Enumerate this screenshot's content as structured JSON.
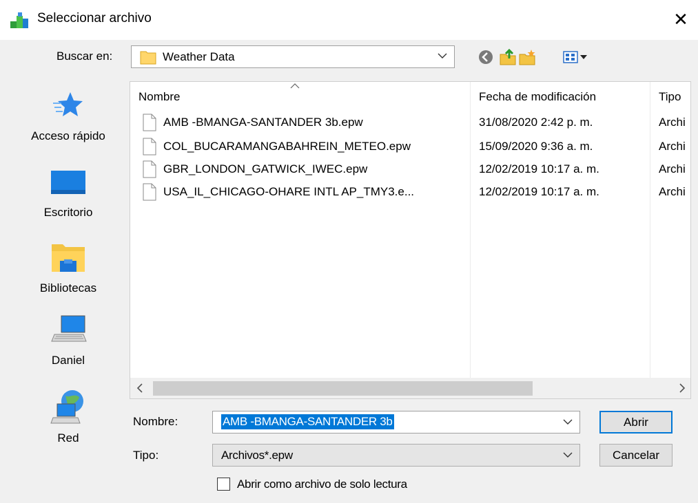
{
  "window": {
    "title": "Seleccionar archivo",
    "close_glyph": "✕"
  },
  "look_in": {
    "label": "Buscar en:",
    "value": "Weather Data"
  },
  "toolbar": {
    "icons": [
      "back-icon",
      "up-folder-icon",
      "new-folder-icon",
      "view-menu-icon"
    ]
  },
  "places": [
    {
      "label": "Acceso rápido",
      "icon": "star-icon"
    },
    {
      "label": "Escritorio",
      "icon": "desktop-icon"
    },
    {
      "label": "Bibliotecas",
      "icon": "libraries-icon"
    },
    {
      "label": "Daniel",
      "icon": "computer-icon"
    },
    {
      "label": "Red",
      "icon": "network-icon"
    }
  ],
  "file_list": {
    "columns": [
      "Nombre",
      "Fecha de modificación",
      "Tipo"
    ],
    "rows": [
      {
        "name": "AMB -BMANGA-SANTANDER 3b.epw",
        "date": "31/08/2020 2:42 p. m.",
        "type": "Archi"
      },
      {
        "name": "COL_BUCARAMANGABAHREIN_METEO.epw",
        "date": "15/09/2020 9:36 a. m.",
        "type": "Archi"
      },
      {
        "name": "GBR_LONDON_GATWICK_IWEC.epw",
        "date": "12/02/2019 10:17 a. m.",
        "type": "Archi"
      },
      {
        "name": "USA_IL_CHICAGO-OHARE INTL AP_TMY3.e...",
        "date": "12/02/2019 10:17 a. m.",
        "type": "Archi"
      }
    ]
  },
  "file_name": {
    "label": "Nombre:",
    "value": "AMB -BMANGA-SANTANDER 3b"
  },
  "file_type": {
    "label": "Tipo:",
    "value": "Archivos*.epw"
  },
  "buttons": {
    "open": "Abrir",
    "cancel": "Cancelar"
  },
  "read_only": {
    "label": "Abrir como archivo de solo lectura",
    "checked": false
  },
  "colors": {
    "accent": "#0078d7",
    "dialog_bg": "#f0f0f0"
  }
}
